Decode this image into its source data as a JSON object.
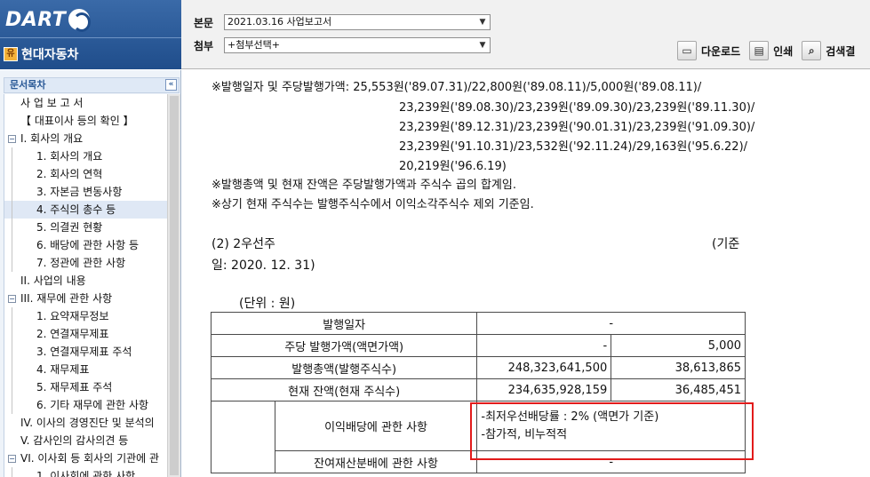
{
  "app": {
    "logo_text": "DART",
    "company_name": "현대자동차",
    "company_icon": "유"
  },
  "header": {
    "report_label": "본문",
    "report_value": "2021.03.16   사업보고서",
    "attachment_label": "첨부",
    "attachment_value": "+첨부선택+",
    "toolbar": [
      {
        "label": "다운로드",
        "icon": "save-icon"
      },
      {
        "label": "인쇄",
        "icon": "print-icon"
      },
      {
        "label": "검색결",
        "icon": "search-icon"
      }
    ]
  },
  "sidebar": {
    "title": "문서목차",
    "collapse_symbol": "«",
    "items": [
      {
        "label": "사 업 보 고 서",
        "level": 0,
        "expander": ""
      },
      {
        "label": "【 대표이사 등의 확인 】",
        "level": 0,
        "expander": ""
      },
      {
        "label": "I. 회사의 개요",
        "level": 0,
        "expander": "−"
      },
      {
        "label": "1. 회사의 개요",
        "level": 1,
        "expander": ""
      },
      {
        "label": "2. 회사의 연혁",
        "level": 1,
        "expander": ""
      },
      {
        "label": "3. 자본금 변동사항",
        "level": 1,
        "expander": ""
      },
      {
        "label": "4. 주식의 총수 등",
        "level": 1,
        "expander": "",
        "selected": true
      },
      {
        "label": "5. 의결권 현황",
        "level": 1,
        "expander": ""
      },
      {
        "label": "6. 배당에 관한 사항 등",
        "level": 1,
        "expander": ""
      },
      {
        "label": "7. 정관에 관한 사항",
        "level": 1,
        "expander": ""
      },
      {
        "label": "II. 사업의 내용",
        "level": 0,
        "expander": ""
      },
      {
        "label": "III. 재무에 관한 사항",
        "level": 0,
        "expander": "−"
      },
      {
        "label": "1. 요약재무정보",
        "level": 1,
        "expander": ""
      },
      {
        "label": "2. 연결재무제표",
        "level": 1,
        "expander": ""
      },
      {
        "label": "3. 연결재무제표 주석",
        "level": 1,
        "expander": ""
      },
      {
        "label": "4. 재무제표",
        "level": 1,
        "expander": ""
      },
      {
        "label": "5. 재무제표 주석",
        "level": 1,
        "expander": ""
      },
      {
        "label": "6. 기타 재무에 관한 사항",
        "level": 1,
        "expander": ""
      },
      {
        "label": "IV. 이사의 경영진단 및 분석의",
        "level": 0,
        "expander": ""
      },
      {
        "label": "V. 감사인의 감사의견 등",
        "level": 0,
        "expander": ""
      },
      {
        "label": "VI. 이사회 등 회사의 기관에 관",
        "level": 0,
        "expander": "−"
      },
      {
        "label": "1. 이사회에 관한 사항",
        "level": 1,
        "expander": ""
      }
    ]
  },
  "doc": {
    "lines": [
      "※발행일자 및 주당발행가액: 25,553원('89.07.31)/22,800원('89.08.11)/5,000원('89.08.11)/",
      "23,239원('89.08.30)/23,239원('89.09.30)/23,239원('89.11.30)/",
      "23,239원('89.12.31)/23,239원('90.01.31)/23,239원('91.09.30)/",
      "23,239원('91.10.31)/23,532원('92.11.24)/29,163원('95.6.22)/",
      "20,219원('96.6.19)",
      "※발행총액 및 현재 잔액은 주당발행가액과 주식수 곱의 합계임.",
      "※상기 현재 주식수는 발행주식수에서 이익소각주식수 제외 기준임."
    ],
    "section_title": "(2) 2우선주",
    "basis_right": "(기준",
    "basis_date": "일:  2020. 12. 31)",
    "unit": "(단위 : 원)"
  },
  "table": {
    "rows": [
      {
        "label": "발행일자",
        "col1": "-",
        "col2": ""
      },
      {
        "label": "주당 발행가액(액면가액)",
        "col1": "-",
        "col2": "5,000"
      },
      {
        "label": "발행총액(발행주식수)",
        "col1": "248,323,641,500",
        "col2": "38,613,865"
      },
      {
        "label": "현재 잔액(현재 주식수)",
        "col1": "234,635,928,159",
        "col2": "36,485,451"
      }
    ],
    "dividend_label": "이익배당에 관한 사항",
    "dividend_line1": "-최저우선배당률 : 2%  (액면가 기준)",
    "dividend_line2": "-참가적, 비누적적",
    "residual_label": "잔여재산분배에 관한 사항",
    "residual_value": "-"
  }
}
